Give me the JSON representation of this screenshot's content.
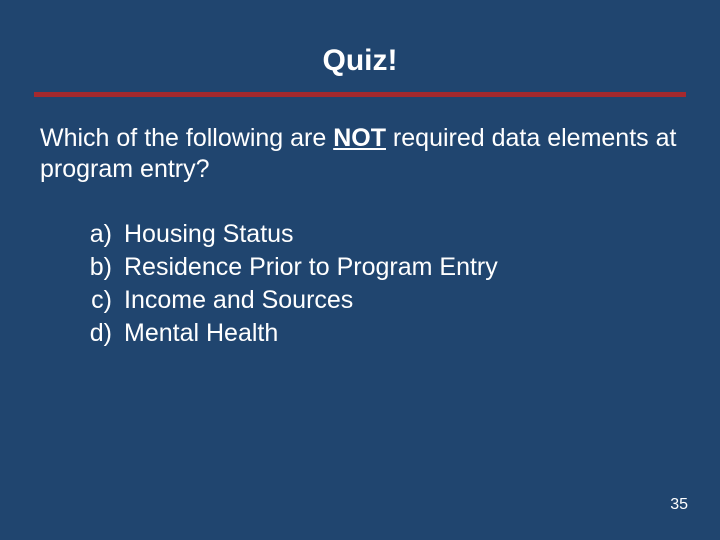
{
  "title": "Quiz!",
  "question_pre": "Which of the following are ",
  "question_emph": "NOT",
  "question_post": " required data elements at program entry?",
  "options": [
    {
      "marker": "a)",
      "text": "Housing Status"
    },
    {
      "marker": "b)",
      "text": "Residence Prior to Program Entry"
    },
    {
      "marker": "c)",
      "text": "Income and Sources"
    },
    {
      "marker": "d)",
      "text": "Mental Health"
    }
  ],
  "page_number": "35",
  "colors": {
    "background": "#20456f",
    "rule": "#a4292e",
    "text": "#ffffff"
  }
}
